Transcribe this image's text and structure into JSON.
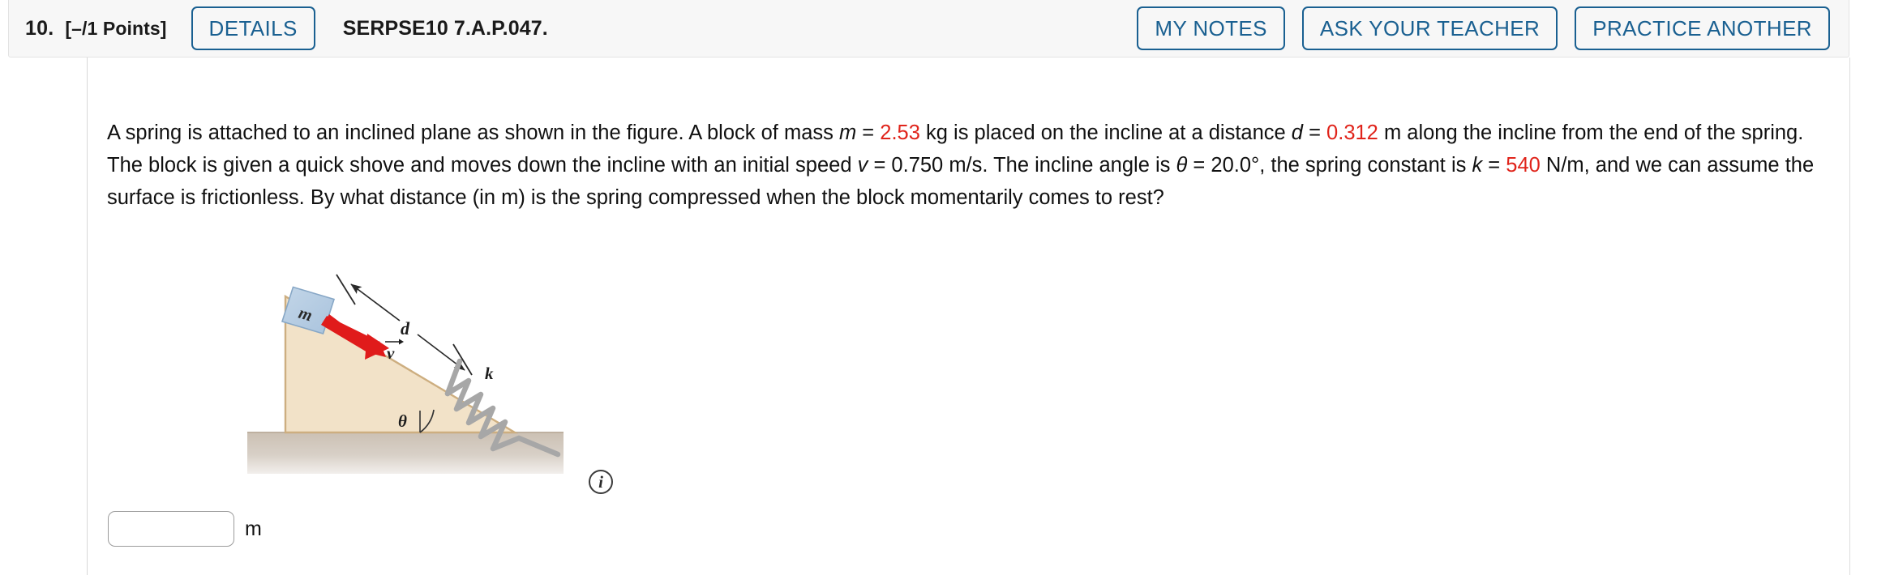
{
  "header": {
    "question_number": "10.",
    "points": "[–/1 Points]",
    "details_label": "DETAILS",
    "question_code": "SERPSE10 7.A.P.047.",
    "my_notes_label": "MY NOTES",
    "ask_teacher_label": "ASK YOUR TEACHER",
    "practice_another_label": "PRACTICE ANOTHER",
    "accent_color": "#1a6091",
    "bar_background": "#f7f7f7"
  },
  "question": {
    "s1": "A spring is attached to an inclined plane as shown in the figure. A block of mass ",
    "var_m": "m",
    "eq1": " = ",
    "val_m": "2.53",
    "s2": " kg is placed on the incline at a distance ",
    "var_d": "d",
    "eq2": " = ",
    "val_d": "0.312",
    "s3": " m along the incline from the end of the spring. The block is given a quick shove and moves down the incline with an initial speed ",
    "var_v": "v",
    "eq3": " = ",
    "val_v": "0.750",
    "s4": " m/s. The incline angle is ",
    "var_theta": "θ",
    "eq4": " = ",
    "val_theta": "20.0°",
    "s5": ", the spring constant is ",
    "var_k": "k",
    "eq5": " = ",
    "val_k": "540",
    "s6": " N/m, and we can assume the surface is frictionless. By what distance (in m) is the spring compressed when the block momentarily comes to rest?",
    "highlight_color": "#e0241b"
  },
  "figure": {
    "label_m": "m",
    "label_d": "d",
    "label_v": "v",
    "label_k": "k",
    "label_theta": "θ",
    "incline_color": "#f0dfc3",
    "incline_edge_color": "#c8a87a",
    "block_color": "#b9cfe4",
    "block_edge_color": "#8aa9c6",
    "arrow_color": "#e01b1b",
    "spring_color": "#a8a8a8",
    "ground_color": "#cdc3b7",
    "info_icon": "info-icon",
    "info_icon_glyph": "i"
  },
  "answer": {
    "value": "",
    "placeholder": "",
    "unit": "m"
  }
}
